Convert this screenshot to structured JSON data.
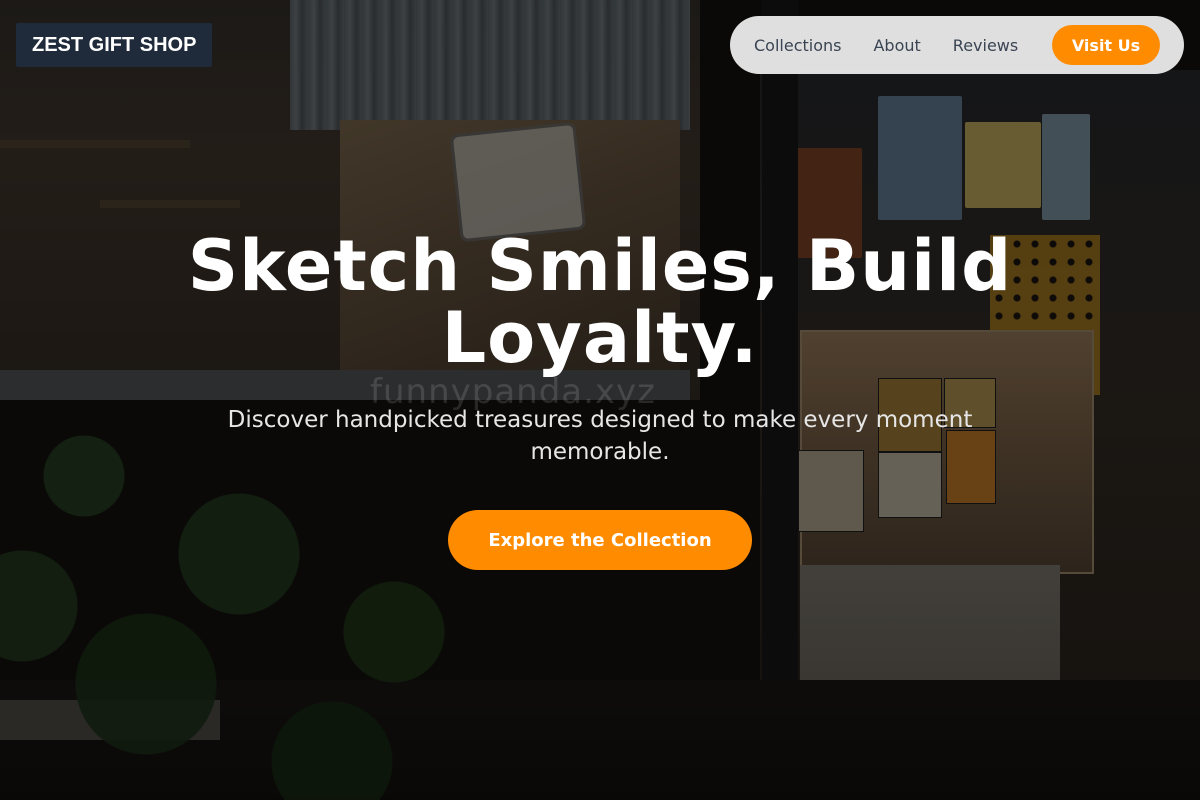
{
  "header": {
    "logo_text": "ZEST GIFT SHOP",
    "nav": [
      {
        "label": "Collections"
      },
      {
        "label": "About"
      },
      {
        "label": "Reviews"
      }
    ],
    "cta_label": "Visit Us"
  },
  "hero": {
    "title": "Sketch Smiles, Build Loyalty.",
    "subtitle": "Discover handpicked treasures designed to make every moment memorable.",
    "cta_label": "Explore the Collection",
    "watermark": "funnypanda.xyz"
  },
  "colors": {
    "accent": "#ff8c00",
    "logo_bg": "#1f2a3a",
    "nav_bg": "#f0f0f0",
    "nav_text": "#3a4453"
  }
}
